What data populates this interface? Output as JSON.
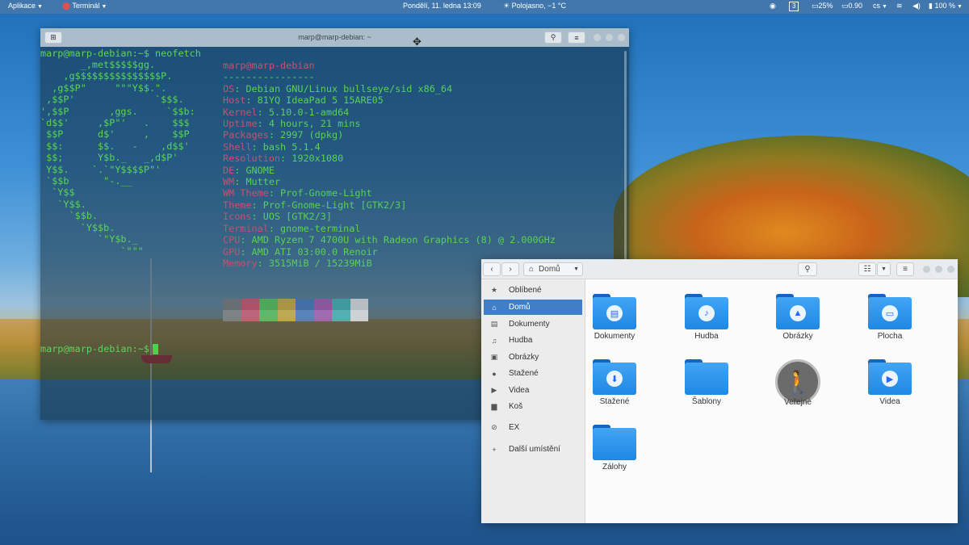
{
  "topbar": {
    "apps": "Aplikace",
    "app_name": "Terminál",
    "clock": "Pondělí, 11. ledna  13:09",
    "weather": "Polojasno, −1 °C",
    "workspace": "3",
    "cpu": "25%",
    "load": "0.90",
    "lang": "cs",
    "battery": "100 %"
  },
  "terminal": {
    "title": "marp@marp-debian: ~",
    "command_prompt": "marp@marp-debian:~$ neofetch",
    "final_prompt": "marp@marp-debian:~$",
    "logo": [
      "       _,met$$$$$gg.",
      "    ,g$$$$$$$$$$$$$$$P.",
      "  ,g$$P\"     \"\"\"Y$$.\".",
      " ,$$P'              `$$$.",
      "',$$P       ,ggs.     `$$b:",
      "`d$$'     ,$P\"'   .    $$$",
      " $$P      d$'     ,    $$P",
      " $$:      $$.   -    ,d$$'",
      " $$;      Y$b._   _,d$P'",
      " Y$$.    `.`\"Y$$$$P\"'",
      " `$$b      \"-.__",
      "  `Y$$",
      "   `Y$$.",
      "     `$$b.",
      "       `Y$$b.",
      "          `\"Y$b._",
      "              `\"\"\""
    ],
    "user_host": "marp@marp-debian",
    "separator": "----------------",
    "info": [
      {
        "k": "OS",
        "v": "Debian GNU/Linux bullseye/sid x86_64"
      },
      {
        "k": "Host",
        "v": "81YQ IdeaPad 5 15ARE05"
      },
      {
        "k": "Kernel",
        "v": "5.10.0-1-amd64"
      },
      {
        "k": "Uptime",
        "v": "4 hours, 21 mins"
      },
      {
        "k": "Packages",
        "v": "2997 (dpkg)"
      },
      {
        "k": "Shell",
        "v": "bash 5.1.4"
      },
      {
        "k": "Resolution",
        "v": "1920x1080"
      },
      {
        "k": "DE",
        "v": "GNOME"
      },
      {
        "k": "WM",
        "v": "Mutter"
      },
      {
        "k": "WM Theme",
        "v": "Prof-Gnome-Light"
      },
      {
        "k": "Theme",
        "v": "Prof-Gnome-Light [GTK2/3]"
      },
      {
        "k": "Icons",
        "v": "UOS [GTK2/3]"
      },
      {
        "k": "Terminal",
        "v": "gnome-terminal"
      },
      {
        "k": "CPU",
        "v": "AMD Ryzen 7 4700U with Radeon Graphics (8) @ 2.000GHz"
      },
      {
        "k": "GPU",
        "v": "AMD ATI 03:00.0 Renoir"
      },
      {
        "k": "Memory",
        "v": "3515MiB / 15239MiB"
      }
    ],
    "swatch_colors_top": [
      "#6f6f6f",
      "#c9475f",
      "#4cba4c",
      "#c6a12e",
      "#3f6fb0",
      "#9c4fa6",
      "#3aa7a7",
      "#d8d8d8"
    ],
    "swatch_colors_bottom": [
      "#8a8a8a",
      "#e0617a",
      "#66d066",
      "#e0bd46",
      "#5b8bd0",
      "#b86bc2",
      "#55c4c4",
      "#f4f4f4"
    ]
  },
  "files": {
    "location": "Domů",
    "sidebar": [
      {
        "label": "Oblíbené",
        "icon": "star-icon",
        "glyph": "★"
      },
      {
        "label": "Domů",
        "icon": "home-icon",
        "glyph": "⌂"
      },
      {
        "label": "Dokumenty",
        "icon": "document-icon",
        "glyph": "▤"
      },
      {
        "label": "Hudba",
        "icon": "music-icon",
        "glyph": "♫"
      },
      {
        "label": "Obrázky",
        "icon": "image-icon",
        "glyph": "▣"
      },
      {
        "label": "Stažené",
        "icon": "download-icon",
        "glyph": "●"
      },
      {
        "label": "Videa",
        "icon": "video-icon",
        "glyph": "▶"
      },
      {
        "label": "Koš",
        "icon": "trash-icon",
        "glyph": "▆"
      },
      {
        "label": "EX",
        "icon": "drive-icon",
        "glyph": "⊘"
      },
      {
        "label": "Další umístění",
        "icon": "plus-icon",
        "glyph": "+"
      }
    ],
    "folders": [
      {
        "label": "Dokumenty",
        "emblem": "▤"
      },
      {
        "label": "Hudba",
        "emblem": "♪"
      },
      {
        "label": "Obrázky",
        "emblem": "▲"
      },
      {
        "label": "Plocha",
        "emblem": "▭"
      },
      {
        "label": "Stažené",
        "emblem": "⬇"
      },
      {
        "label": "Šablony",
        "emblem": ""
      },
      {
        "label": "Veřejné",
        "emblem": "🚶"
      },
      {
        "label": "Videa",
        "emblem": "▶"
      },
      {
        "label": "Zálohy",
        "emblem": ""
      }
    ]
  }
}
